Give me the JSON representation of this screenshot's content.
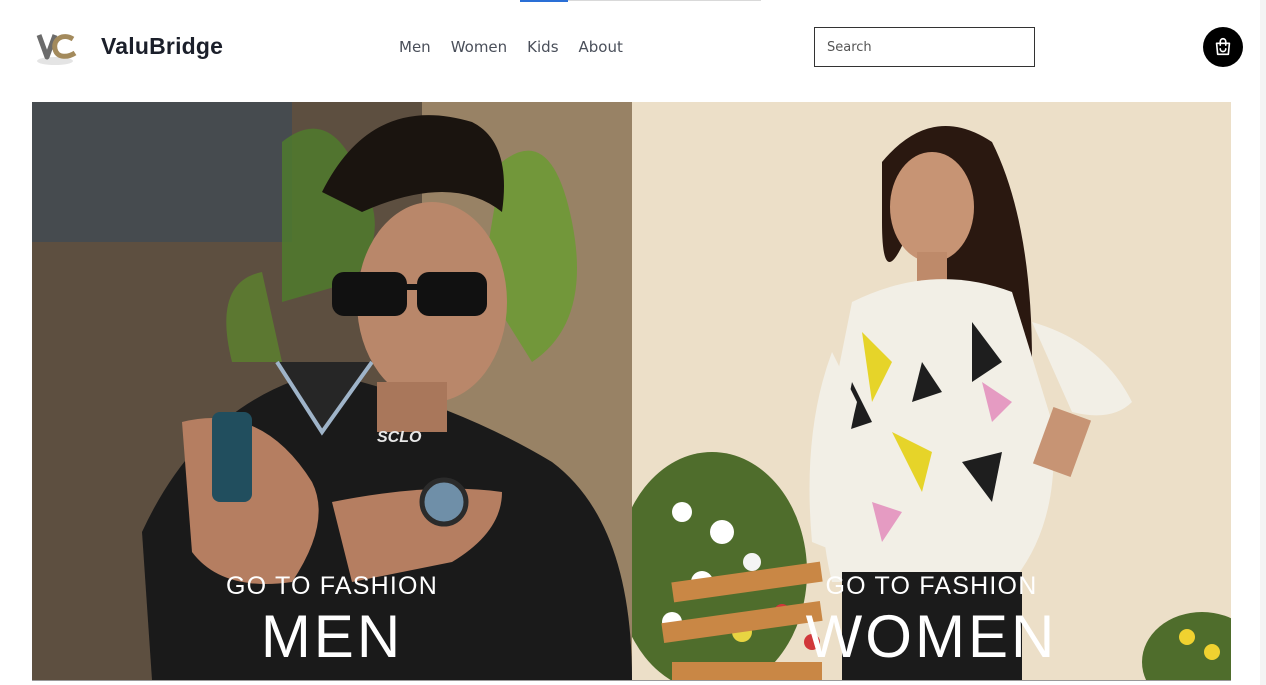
{
  "brand": {
    "name": "ValuBridge"
  },
  "nav": {
    "items": [
      "Men",
      "Women",
      "Kids",
      "About"
    ]
  },
  "search": {
    "placeholder": "Search",
    "value": ""
  },
  "cart": {
    "icon": "shopping-bag-icon"
  },
  "hero": {
    "men": {
      "subtitle": "GO TO FASHION",
      "title": "MEN",
      "shirt_print": "SCLO"
    },
    "women": {
      "subtitle": "GO TO FASHION",
      "title": "WOMEN"
    }
  },
  "colors": {
    "accent": "#2a6fd6",
    "cart_bg": "#000000",
    "brand_text": "#1b1f2a"
  }
}
